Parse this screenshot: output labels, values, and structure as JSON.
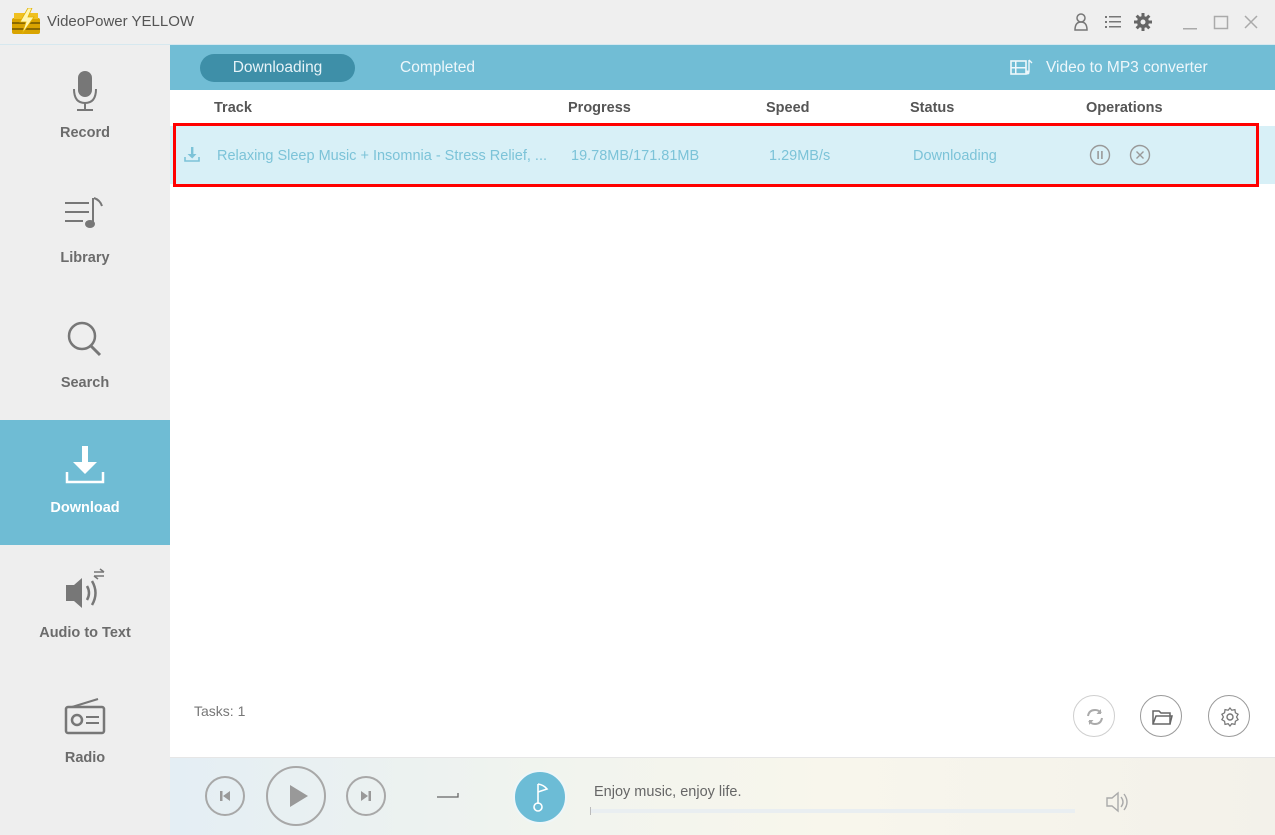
{
  "window": {
    "title": "VideoPower YELLOW",
    "controls": [
      "user-icon",
      "menu-list-icon",
      "settings-gear-icon",
      "minimize-icon",
      "maximize-icon",
      "close-icon"
    ]
  },
  "sidebar": {
    "items": [
      {
        "label": "Record",
        "icon": "microphone-icon",
        "active": false
      },
      {
        "label": "Library",
        "icon": "music-list-icon",
        "active": false
      },
      {
        "label": "Search",
        "icon": "search-icon",
        "active": false
      },
      {
        "label": "Download",
        "icon": "download-icon",
        "active": true
      },
      {
        "label": "Audio to Text",
        "icon": "speaker-convert-icon",
        "active": false
      },
      {
        "label": "Radio",
        "icon": "radio-icon",
        "active": false
      }
    ]
  },
  "tabs": {
    "items": [
      {
        "label": "Downloading",
        "active": true
      },
      {
        "label": "Completed",
        "active": false
      }
    ],
    "converter_label": "Video to MP3 converter"
  },
  "table": {
    "headers": {
      "track": "Track",
      "progress": "Progress",
      "speed": "Speed",
      "status": "Status",
      "operations": "Operations"
    },
    "rows": [
      {
        "track": "Relaxing Sleep Music + Insomnia - Stress Relief, ...",
        "progress": "19.78MB/171.81MB",
        "speed": "1.29MB/s",
        "status": "Downloading",
        "operations": [
          "pause-icon",
          "cancel-icon"
        ]
      }
    ]
  },
  "footer": {
    "tasks_label": "Tasks: 1",
    "buttons": [
      "refresh-icon",
      "folder-icon",
      "settings-icon"
    ]
  },
  "player": {
    "tagline": "Enjoy music, enjoy life.",
    "repeat_mode": "sequential",
    "progress_fraction": 0
  },
  "colors": {
    "accent": "#71bdd5",
    "active_tab": "#3e8fa8",
    "row_bg": "#d8f0f7",
    "row_text": "#7cc3d8",
    "highlight": "#ff0000"
  }
}
